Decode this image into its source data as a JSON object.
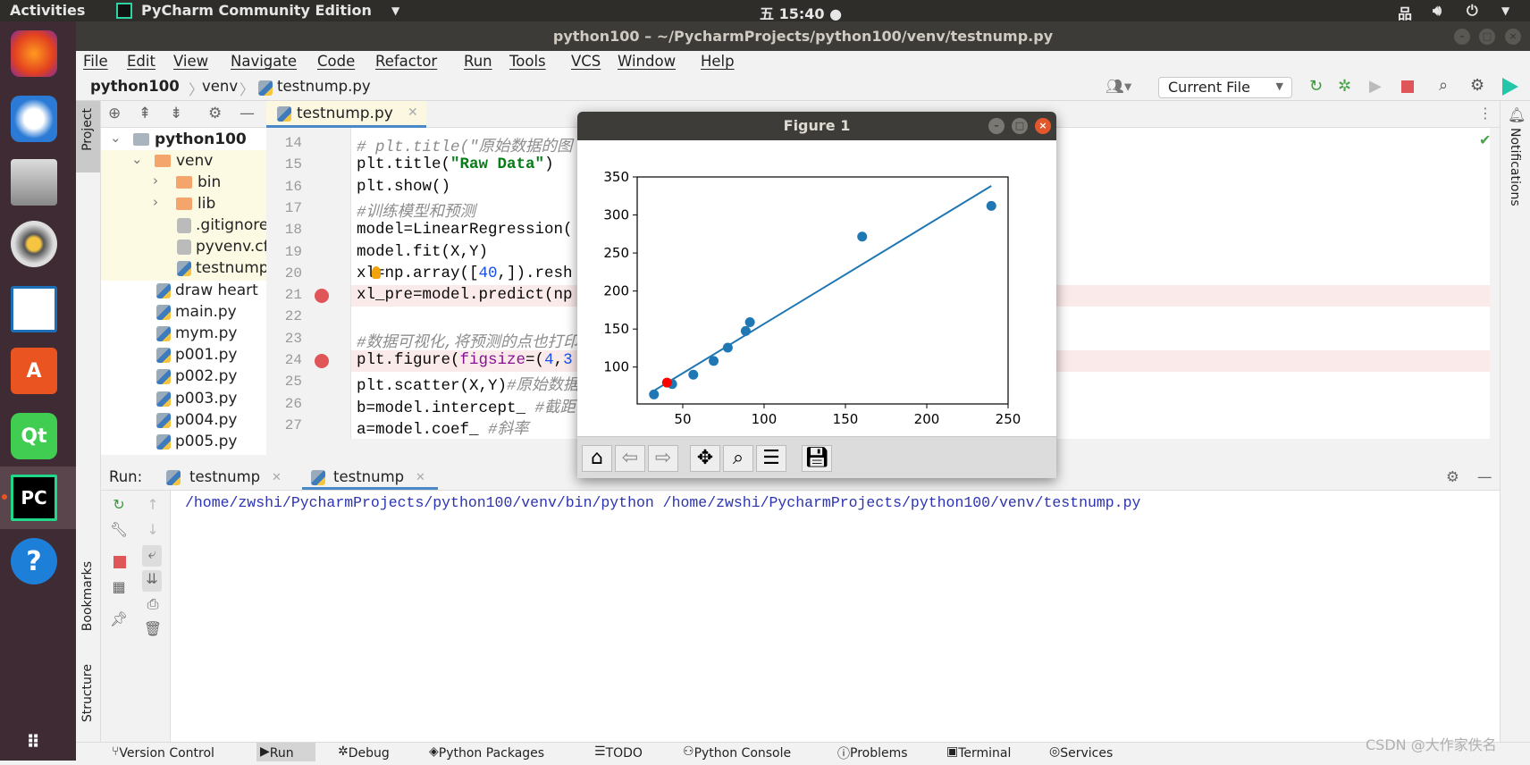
{
  "topbar": {
    "activities": "Activities",
    "app_name": "PyCharm Community Edition",
    "clock": "五 15:40 ●"
  },
  "window": {
    "title": "python100 – ~/PycharmProjects/python100/venv/testnump.py"
  },
  "menu": [
    "File",
    "Edit",
    "View",
    "Navigate",
    "Code",
    "Refactor",
    "Run",
    "Tools",
    "VCS",
    "Window",
    "Help"
  ],
  "breadcrumb": [
    "python100",
    "venv",
    "testnump.py"
  ],
  "toolbar": {
    "run_config": "Current File"
  },
  "side_labels": {
    "project": "Project",
    "bookmarks": "Bookmarks",
    "structure": "Structure",
    "notifications": "Notifications"
  },
  "tree": [
    {
      "label": "python100",
      "type": "root"
    },
    {
      "label": "venv",
      "type": "folder"
    },
    {
      "label": "bin",
      "type": "folder"
    },
    {
      "label": "lib",
      "type": "folder"
    },
    {
      "label": ".gitignore",
      "type": "file"
    },
    {
      "label": "pyvenv.cfg",
      "type": "file"
    },
    {
      "label": "testnump.py",
      "type": "py"
    },
    {
      "label": "draw heart",
      "type": "py"
    },
    {
      "label": "main.py",
      "type": "py"
    },
    {
      "label": "mym.py",
      "type": "py"
    },
    {
      "label": "p001.py",
      "type": "py"
    },
    {
      "label": "p002.py",
      "type": "py"
    },
    {
      "label": "p003.py",
      "type": "py"
    },
    {
      "label": "p004.py",
      "type": "py"
    },
    {
      "label": "p005.py",
      "type": "py"
    }
  ],
  "editor": {
    "tab": "testnump.py",
    "lines": [
      {
        "n": "14",
        "parts": [
          [
            "cm",
            "# plt.title(\"原始数据的图"
          ]
        ]
      },
      {
        "n": "15",
        "parts": [
          [
            "",
            "plt.title("
          ],
          [
            "st",
            "\"Raw Data\""
          ],
          [
            "",
            ")"
          ]
        ]
      },
      {
        "n": "16",
        "parts": [
          [
            "",
            "plt.show()"
          ]
        ]
      },
      {
        "n": "17",
        "parts": [
          [
            "cm",
            "#训练模型和预测"
          ]
        ]
      },
      {
        "n": "18",
        "parts": [
          [
            "",
            "model=LinearRegression("
          ]
        ]
      },
      {
        "n": "19",
        "parts": [
          [
            "",
            "model.fit(X,Y)"
          ]
        ]
      },
      {
        "n": "20",
        "parts": [
          [
            "",
            "xl=np.array(["
          ],
          [
            "nm",
            "40"
          ],
          [
            "",
            ",]).resh"
          ]
        ]
      },
      {
        "n": "21",
        "parts": [
          [
            "",
            "xl_pre=model.predict(np"
          ]
        ],
        "breakpoint": true
      },
      {
        "n": "22",
        "parts": []
      },
      {
        "n": "23",
        "parts": [
          [
            "cm",
            "#数据可视化,将预测的点也打印"
          ]
        ]
      },
      {
        "n": "24",
        "parts": [
          [
            "",
            "plt.figure("
          ],
          [
            "kw",
            "figsize"
          ],
          [
            "",
            "=("
          ],
          [
            "nm",
            "4"
          ],
          [
            "",
            ","
          ],
          [
            "nm",
            "3"
          ]
        ],
        "breakpoint": true
      },
      {
        "n": "25",
        "parts": [
          [
            "",
            "plt.scatter(X,Y)"
          ],
          [
            "cm",
            "#原始数据"
          ]
        ]
      },
      {
        "n": "26",
        "parts": [
          [
            "",
            "b=model.intercept_ "
          ],
          [
            "cm",
            "#截距"
          ]
        ]
      },
      {
        "n": "27",
        "parts": [
          [
            "",
            "a=model.coef_ "
          ],
          [
            "cm",
            "#斜率"
          ]
        ]
      }
    ]
  },
  "run": {
    "label": "Run:",
    "tabs": [
      "testnump",
      "testnump"
    ],
    "output": "/home/zwshi/PycharmProjects/python100/venv/bin/python /home/zwshi/PycharmProjects/python100/venv/testnump.py"
  },
  "statusbar": [
    "Version Control",
    "Run",
    "Debug",
    "Python Packages",
    "TODO",
    "Python Console",
    "Problems",
    "Terminal",
    "Services"
  ],
  "watermark": "CSDN @大作家佚名",
  "figure": {
    "title": "Figure 1"
  },
  "chart_data": {
    "type": "scatter",
    "xlim": [
      22,
      250
    ],
    "ylim": [
      51.5,
      350
    ],
    "xticks": [
      50,
      100,
      150,
      200,
      250
    ],
    "yticks": [
      100,
      150,
      200,
      250,
      300,
      350
    ],
    "points": [
      [
        32.3,
        64
      ],
      [
        43.5,
        77.7
      ],
      [
        56.5,
        90
      ],
      [
        69,
        108
      ],
      [
        77.7,
        125.5
      ],
      [
        88.7,
        147.4
      ],
      [
        91.3,
        159
      ],
      [
        160.3,
        271.6
      ],
      [
        239.7,
        312
      ]
    ],
    "predicted_point": [
      40.3,
      79.6
    ],
    "fit_line": [
      [
        30.6,
        66.7
      ],
      [
        239.7,
        338.2
      ]
    ],
    "colors": {
      "points": "#1f77b4",
      "line": "#1f77b4",
      "predicted": "#ff0000"
    },
    "grid": false
  }
}
